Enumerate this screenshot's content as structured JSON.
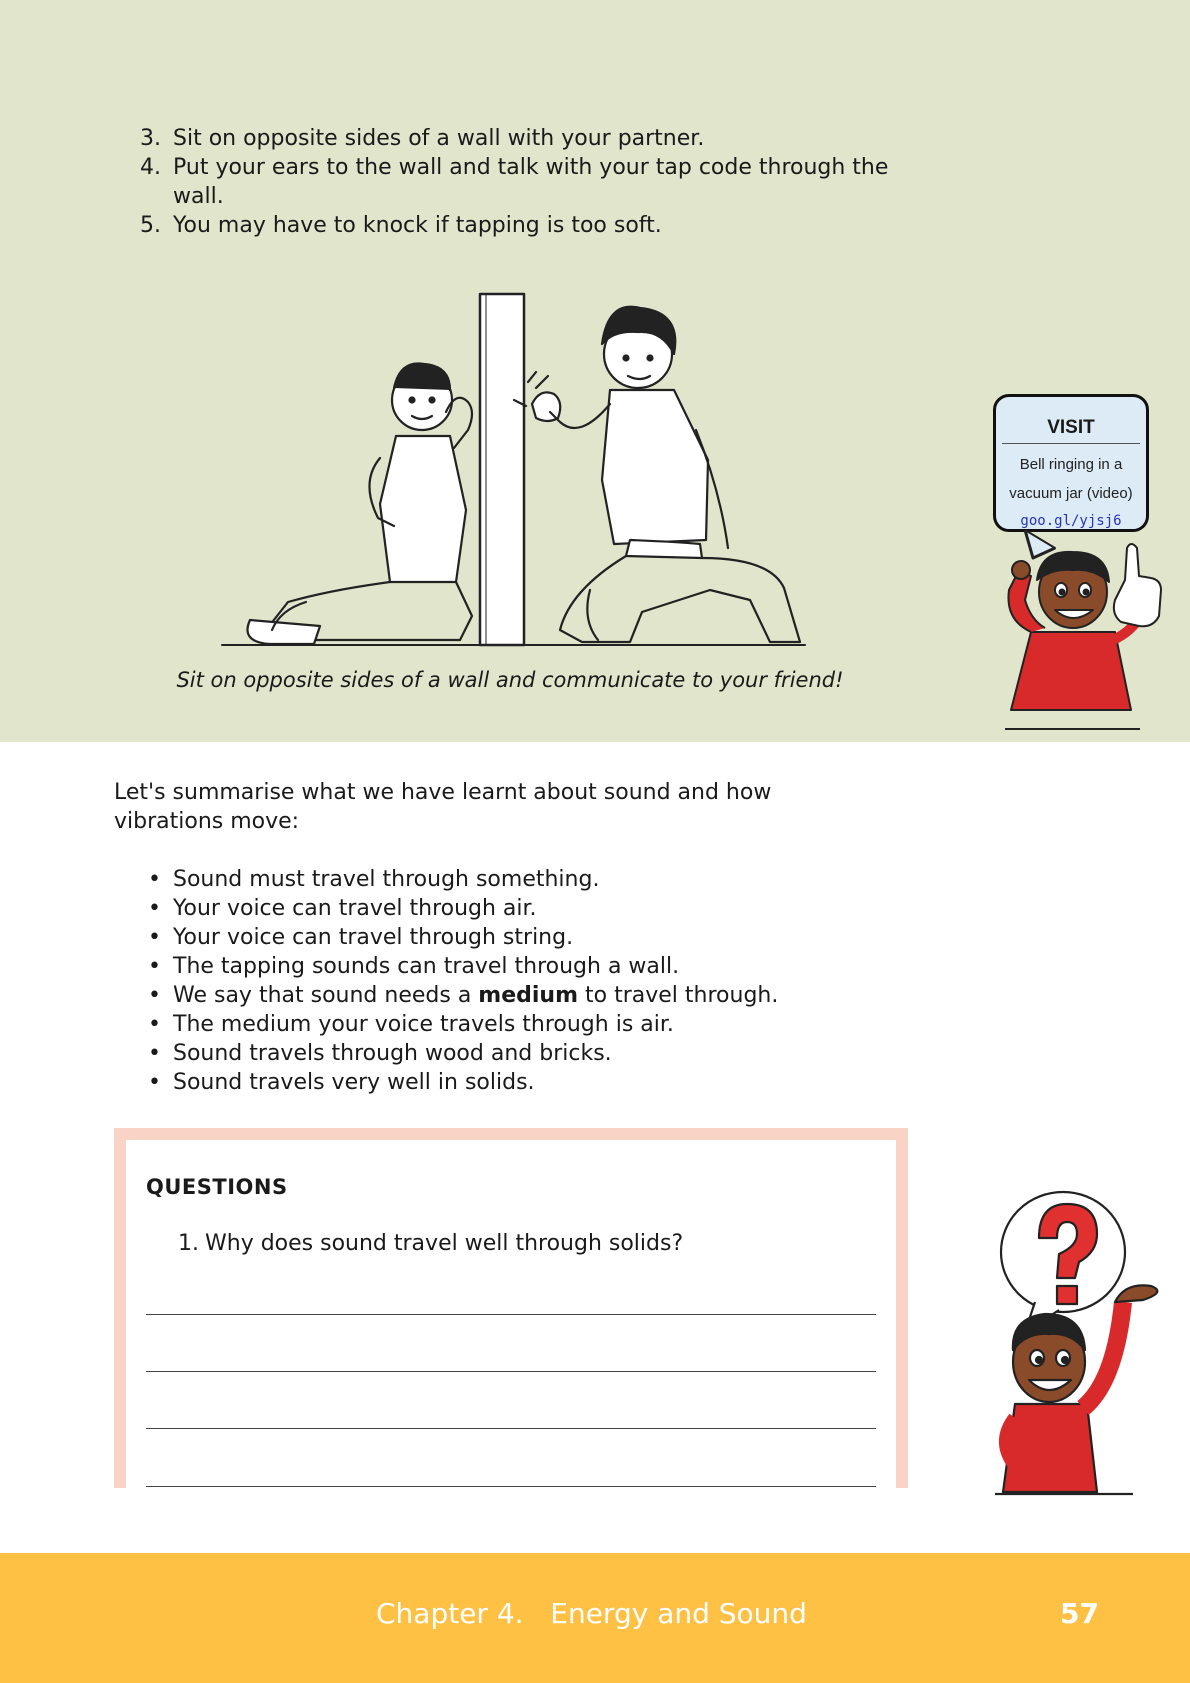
{
  "colors": {
    "green": "#e0e5cc",
    "yellow": "#fec144",
    "pink": "#f9d3c6",
    "visit_blue": "#dcebf5"
  },
  "steps": [
    {
      "num": "3.",
      "text": "Sit on opposite sides of a wall with your partner."
    },
    {
      "num": "4.",
      "text": "Put your ears to the wall and talk with your tap code through the wall."
    },
    {
      "num": "5.",
      "text": "You may have to knock if tapping is too soft."
    }
  ],
  "illustration_caption": "Sit on opposite sides of a wall and communicate to your friend!",
  "visit": {
    "heading": "VISIT",
    "line1": "Bell ringing in a",
    "line2": "vacuum jar (video)",
    "url": "goo.gl/yjsj6",
    "icons": [
      "pointing-hand-icon"
    ]
  },
  "summary": {
    "intro": "Let's summarise what we have learnt about sound and how vibrations move:",
    "bullets": [
      "Sound must travel through something.",
      "Your voice can travel through air.",
      "Your voice can travel through string.",
      "The tapping sounds can travel through a wall.",
      "We say that sound needs a ",
      "The medium your voice travels through is air.",
      "Sound travels through wood and bricks.",
      "Sound travels very well in solids."
    ],
    "bullet5_bold": "medium",
    "bullet5_rest": " to travel through."
  },
  "questions": {
    "title": "QUESTIONS",
    "items": [
      {
        "num": "1.",
        "text": "Why does sound travel well through solids?"
      }
    ],
    "icon": "question-mark-icon"
  },
  "footer": {
    "chapter": "Chapter 4.   Energy and Sound",
    "page_number": "57"
  }
}
